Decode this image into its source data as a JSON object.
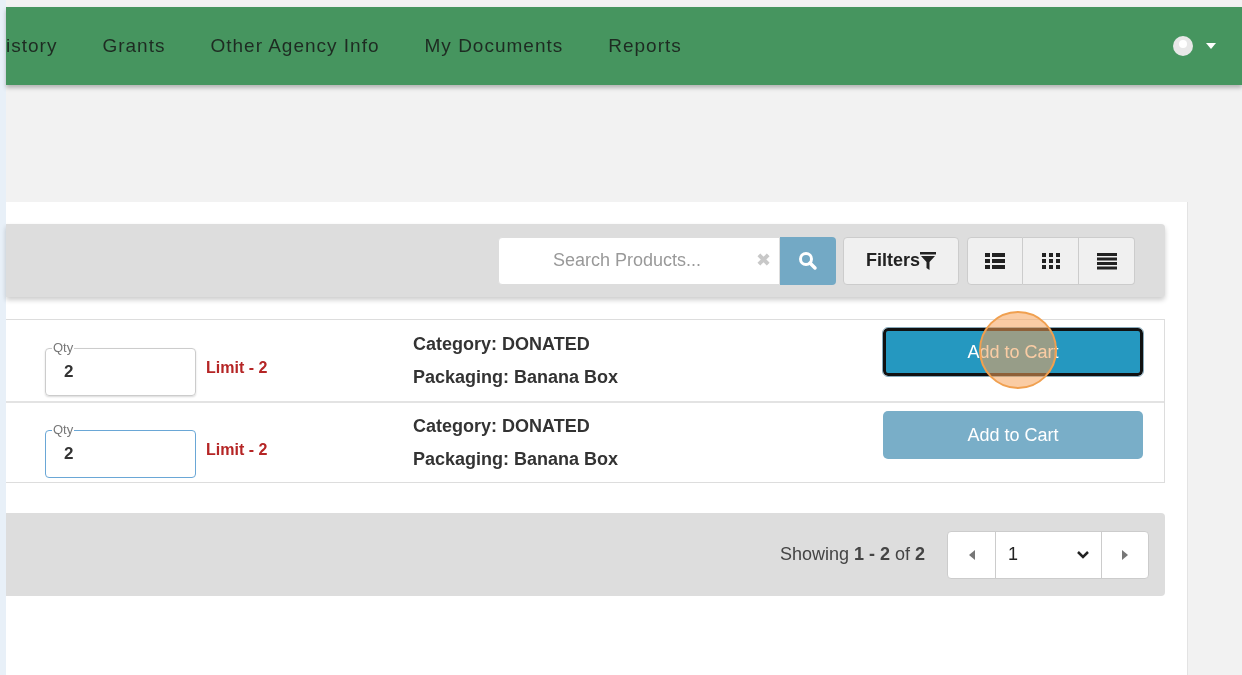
{
  "nav": {
    "items": [
      {
        "label": "istory"
      },
      {
        "label": "Grants"
      },
      {
        "label": "Other Agency Info"
      },
      {
        "label": "My Documents"
      },
      {
        "label": "Reports"
      }
    ]
  },
  "toolbar": {
    "search": {
      "placeholder": "Search Products..."
    },
    "clear": "✖",
    "filters": "Filters",
    "views": [
      {
        "kind": "list",
        "selected": false
      },
      {
        "kind": "grid",
        "selected": false
      },
      {
        "kind": "table",
        "selected": false
      }
    ]
  },
  "products": [
    {
      "qty_label": "Qty",
      "qty": "2",
      "qty_focused": false,
      "limit": "Limit - 2",
      "category": "Category: DONATED",
      "packaging": "Packaging: Banana Box",
      "button": "Add to Cart",
      "button_focused": true,
      "click_highlight": true
    },
    {
      "qty_label": "Qty",
      "qty": "2",
      "qty_focused": true,
      "limit": "Limit - 2",
      "category": "Category: DONATED",
      "packaging": "Packaging: Banana Box",
      "button": "Add to Cart",
      "button_focused": false,
      "click_highlight": false
    }
  ],
  "footer": {
    "showing": "Showing **1 - 2** of **2**",
    "page": "1"
  }
}
